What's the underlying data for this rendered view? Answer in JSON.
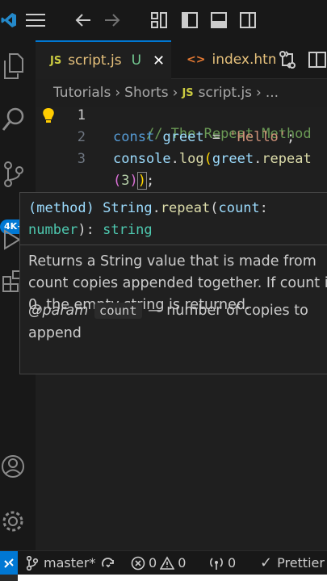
{
  "titlebar": {
    "icons": [
      "vscode-logo",
      "menu-icon",
      "back-arrow-icon",
      "forward-arrow-icon",
      "layout-customize-icon",
      "toggle-primary-sidebar-icon",
      "toggle-panel-icon",
      "toggle-secondary-sidebar-icon"
    ]
  },
  "activitybar": {
    "badge": "4K+",
    "icons": [
      "explorer-icon",
      "search-icon",
      "source-control-icon",
      "run-debug-icon",
      "extensions-icon",
      "account-icon",
      "settings-gear-icon"
    ]
  },
  "tabs": [
    {
      "icon": "JS",
      "label": "script.js",
      "modified": "U",
      "active": true
    },
    {
      "icon": "<>",
      "label": "index.html",
      "active": false
    }
  ],
  "tab_actions": [
    "compare-changes-icon",
    "split-editor-icon"
  ],
  "breadcrumb": {
    "parts": [
      "Tutorials",
      "Shorts",
      "script.js",
      "..."
    ],
    "file_icon": "JS"
  },
  "editor": {
    "line_numbers": [
      "1",
      "2",
      "3"
    ],
    "current_line": "1",
    "lines": [
      {
        "comment": "// The Repeat Method"
      },
      {
        "kw": "const",
        "var": "greet",
        "op": "=",
        "str": "'Hello'",
        "end": ";"
      },
      {
        "obj": "console",
        "dot": ".",
        "fn": "log",
        "p1": "(",
        "var": "greet",
        "dot2": ".",
        "method": "repeat"
      },
      {
        "p2open": "(",
        "num": "3",
        "p2close": ")",
        "p1close": ")",
        "end": ";"
      }
    ]
  },
  "hover": {
    "signature_line1": "(method) String.repeat(count:",
    "signature_line2": "number): string",
    "sig_parts": {
      "kind": "(method)",
      "owner": "String",
      "dot": ".",
      "name": "repeat",
      "open": "(",
      "param": "count",
      "colon": ":",
      "param_type": "number",
      "close": "):",
      "return_type": "string"
    },
    "doc_line1": "Returns a String value that is made from",
    "doc_line2": "count copies appended together. If count is",
    "doc_line3": "0, the empty string is returned.",
    "param_tag": "@param",
    "param_name": "count",
    "param_desc": "— number of copies to",
    "param_desc2": "append"
  },
  "statusbar": {
    "remote_icon": "remote-icon",
    "branch": "master*",
    "sync_icon": "sync-icon",
    "errors": "0",
    "warnings": "0",
    "ports": "0",
    "prettier": "Prettier"
  }
}
